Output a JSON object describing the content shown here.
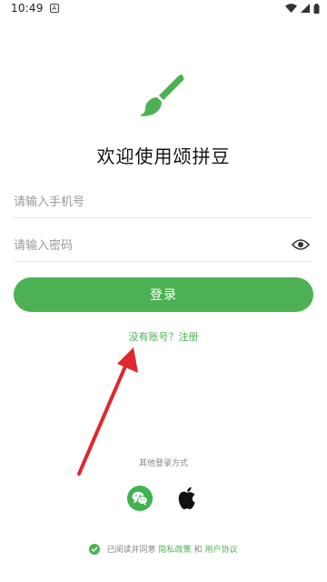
{
  "status_bar": {
    "time": "10:49",
    "notification_glyph": "A",
    "icons": [
      "wifi-icon",
      "signal-icon",
      "battery-icon"
    ]
  },
  "brand": {
    "logo_icon": "paintbrush-icon",
    "welcome_title": "欢迎使用颂拼豆"
  },
  "form": {
    "phone_placeholder": "请输入手机号",
    "phone_value": "",
    "password_placeholder": "请输入密码",
    "password_value": "",
    "password_toggle_icon": "eye-icon",
    "login_label": "登录",
    "register_link": "没有账号？注册"
  },
  "other_login": {
    "title": "其他登录方式",
    "options": [
      "wechat-icon",
      "apple-icon"
    ]
  },
  "agreement": {
    "prefix": "已阅读并同意",
    "privacy_link": "隐私政策",
    "conjunction": "和",
    "terms_link": "用户协议",
    "checked": true
  },
  "colors": {
    "accent": "#4db153",
    "annotation_arrow": "#e0282e"
  }
}
